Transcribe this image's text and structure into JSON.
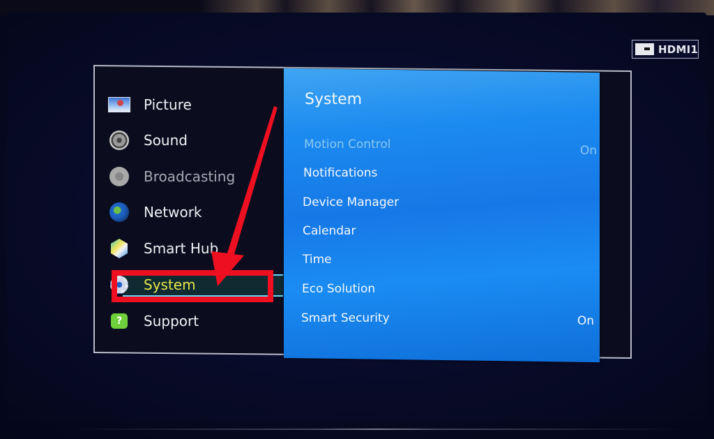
{
  "source_badge": {
    "icon": "hdmi-port-icon",
    "label": "HDMI1"
  },
  "main_menu": {
    "items": [
      {
        "label": "Picture",
        "icon": "picture-icon",
        "state": "normal"
      },
      {
        "label": "Sound",
        "icon": "speaker-icon",
        "state": "normal"
      },
      {
        "label": "Broadcasting",
        "icon": "satellite-dish-icon",
        "state": "disabled"
      },
      {
        "label": "Network",
        "icon": "globe-icon",
        "state": "normal"
      },
      {
        "label": "Smart Hub",
        "icon": "cube-icon",
        "state": "normal"
      },
      {
        "label": "System",
        "icon": "gear-icon",
        "state": "selected"
      },
      {
        "label": "Support",
        "icon": "help-bubble-icon",
        "state": "normal"
      }
    ]
  },
  "submenu": {
    "title": "System",
    "items": [
      {
        "label": "Motion Control",
        "value": "On",
        "state": "disabled"
      },
      {
        "label": "Notifications",
        "value": "",
        "state": "normal"
      },
      {
        "label": "Device Manager",
        "value": "",
        "state": "normal"
      },
      {
        "label": "Calendar",
        "value": "",
        "state": "normal"
      },
      {
        "label": "Time",
        "value": "",
        "state": "normal"
      },
      {
        "label": "Eco Solution",
        "value": "",
        "state": "normal"
      },
      {
        "label": "Smart Security",
        "value": "On",
        "state": "normal"
      }
    ]
  },
  "annotation": {
    "color": "#ee1020",
    "target": "System"
  },
  "colors": {
    "selected_text": "#e8e64a",
    "submenu_blue": "#1678e6",
    "highlight_line": "#6fd3f3"
  }
}
